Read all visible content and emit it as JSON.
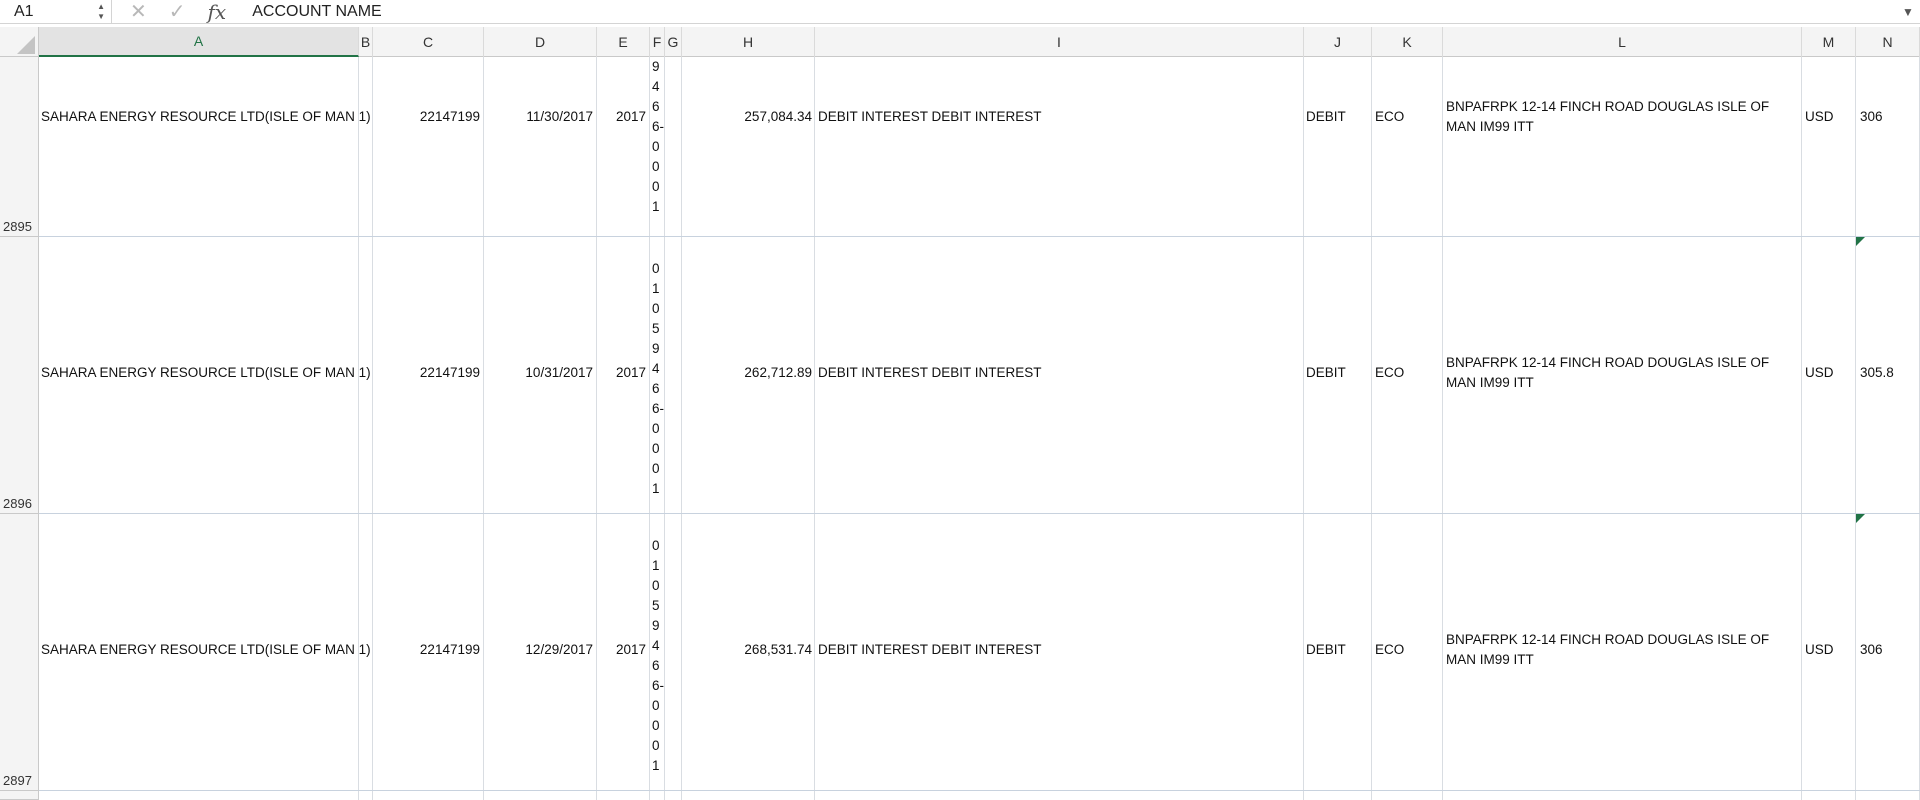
{
  "formula_bar": {
    "cell_ref": "A1",
    "content": "ACCOUNT NAME"
  },
  "columns": [
    "A",
    "B",
    "C",
    "D",
    "E",
    "F",
    "G",
    "H",
    "I",
    "J",
    "K",
    "L",
    "M",
    "N"
  ],
  "selected_column": "A",
  "rows": [
    {
      "number": "2895",
      "account_name": "SAHARA ENERGY RESOURCE LTD(ISLE OF MAN 1)",
      "account_no": "22147199",
      "date": "11/30/2017",
      "year": "2017",
      "ref_chars": [
        "9",
        "4",
        "6",
        "6-",
        "0",
        "0",
        "0",
        "1"
      ],
      "amount": "257,084.34",
      "description": "DEBIT INTEREST DEBIT INTEREST",
      "type": "DEBIT",
      "category": "ECO",
      "bank_address": "BNPAFRPK 12-14 FINCH ROAD DOUGLAS ISLE OF MAN IM99 ITT",
      "currency": "USD",
      "rate": "306"
    },
    {
      "number": "2896",
      "account_name": "SAHARA ENERGY RESOURCE LTD(ISLE OF MAN 1)",
      "account_no": "22147199",
      "date": "10/31/2017",
      "year": "2017",
      "ref_chars": [
        "0",
        "1",
        "0",
        "5",
        "9",
        "4",
        "6",
        "6-",
        "0",
        "0",
        "0",
        "1"
      ],
      "amount": "262,712.89",
      "description": "DEBIT INTEREST DEBIT INTEREST",
      "type": "DEBIT",
      "category": "ECO",
      "bank_address": "BNPAFRPK 12-14 FINCH ROAD DOUGLAS ISLE OF MAN IM99 ITT",
      "currency": "USD",
      "rate": "305.8"
    },
    {
      "number": "2897",
      "account_name": "SAHARA ENERGY RESOURCE LTD(ISLE OF MAN 1)",
      "account_no": "22147199",
      "date": "12/29/2017",
      "year": "2017",
      "ref_chars": [
        "0",
        "1",
        "0",
        "5",
        "9",
        "4",
        "6",
        "6-",
        "0",
        "0",
        "0",
        "1"
      ],
      "amount": "268,531.74",
      "description": "DEBIT INTEREST DEBIT INTEREST",
      "type": "DEBIT",
      "category": "ECO",
      "bank_address": "BNPAFRPK 12-14 FINCH ROAD DOUGLAS ISLE OF MAN IM99 ITT",
      "currency": "USD",
      "rate": "306"
    }
  ],
  "colors": {
    "header_bg": "#f4f4f4",
    "selected_accent": "#217346",
    "gridline": "#d9dde2"
  },
  "icons": {
    "cancel": "close-icon",
    "confirm": "check-icon",
    "function": "fx-icon"
  }
}
